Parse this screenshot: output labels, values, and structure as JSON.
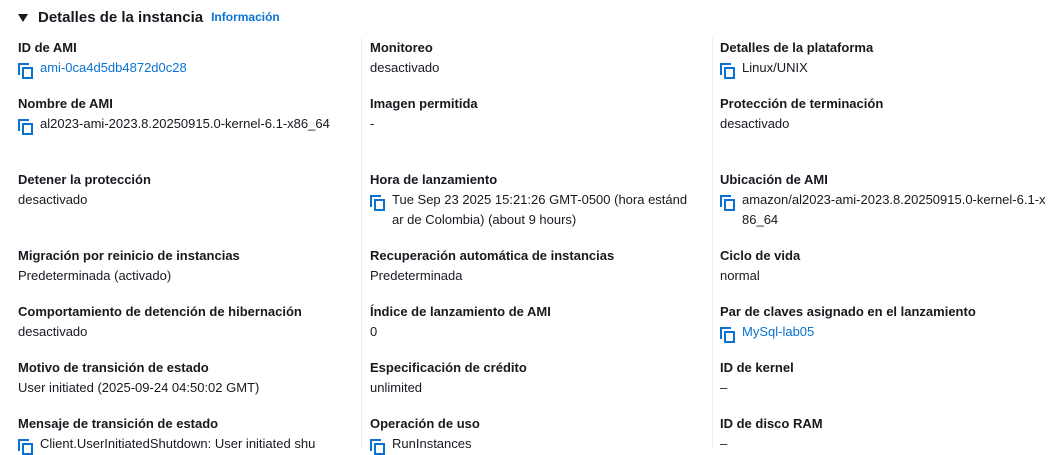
{
  "header": {
    "title": "Detalles de la instancia",
    "info_link": "Información"
  },
  "columns": [
    [
      {
        "label": "ID de AMI",
        "value": "ami-0ca4d5db4872d0c28",
        "copy": true,
        "link": true
      },
      {
        "label": "Nombre de AMI",
        "value": "al2023-ami-2023.8.20250915.0-kernel-6.1-x86_64",
        "copy": true,
        "link": false
      },
      {
        "label": "Detener la protección",
        "value": "desactivado",
        "copy": false,
        "link": false
      },
      {
        "label": "Migración por reinicio de instancias",
        "value": "Predeterminada (activado)",
        "copy": false,
        "link": false
      },
      {
        "label": "Comportamiento de detención de hibernación",
        "value": "desactivado",
        "copy": false,
        "link": false
      },
      {
        "label": "Motivo de transición de estado",
        "value": "User initiated (2025-09-24 04:50:02 GMT)",
        "copy": false,
        "link": false
      },
      {
        "label": "Mensaje de transición de estado",
        "value": "Client.UserInitiatedShutdown: User initiated shu",
        "copy": true,
        "link": false
      }
    ],
    [
      {
        "label": "Monitoreo",
        "value": "desactivado",
        "copy": false,
        "link": false
      },
      {
        "label": "Imagen permitida",
        "value": "-",
        "copy": false,
        "link": false
      },
      {
        "label": "Hora de lanzamiento",
        "value": "Tue Sep 23 2025 15:21:26 GMT-0500 (hora estándar de Colombia) (about 9 hours)",
        "copy": true,
        "link": false
      },
      {
        "label": "Recuperación automática de instancias",
        "value": "Predeterminada",
        "copy": false,
        "link": false
      },
      {
        "label": "Índice de lanzamiento de AMI",
        "value": "0",
        "copy": false,
        "link": false
      },
      {
        "label": "Especificación de crédito",
        "value": "unlimited",
        "copy": false,
        "link": false
      },
      {
        "label": "Operación de uso",
        "value": "RunInstances",
        "copy": true,
        "link": false
      }
    ],
    [
      {
        "label": "Detalles de la plataforma",
        "value": "Linux/UNIX",
        "copy": true,
        "link": false
      },
      {
        "label": "Protección de terminación",
        "value": "desactivado",
        "copy": false,
        "link": false
      },
      {
        "label": "Ubicación de AMI",
        "value": "amazon/al2023-ami-2023.8.20250915.0-kernel-6.1-x86_64",
        "copy": true,
        "link": false
      },
      {
        "label": "Ciclo de vida",
        "value": "normal",
        "copy": false,
        "link": false
      },
      {
        "label": "Par de claves asignado en el lanzamiento",
        "value": "MySql-lab05",
        "copy": true,
        "link": true
      },
      {
        "label": "ID de kernel",
        "value": "–",
        "copy": false,
        "link": false
      },
      {
        "label": "ID de disco RAM",
        "value": "–",
        "copy": false,
        "link": false
      }
    ]
  ]
}
